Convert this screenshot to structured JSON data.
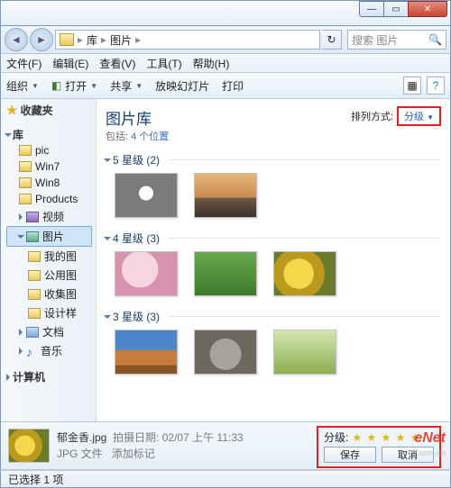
{
  "window": {
    "breadcrumb": {
      "root": "库",
      "lib": "图片"
    },
    "search_placeholder": "搜索 图片"
  },
  "menubar": {
    "file": "文件(F)",
    "edit": "编辑(E)",
    "view": "查看(V)",
    "tools": "工具(T)",
    "help": "帮助(H)"
  },
  "toolbar": {
    "organize": "组织",
    "open": "打开",
    "share": "共享",
    "slideshow": "放映幻灯片",
    "print": "打印"
  },
  "sidebar": {
    "favorites": "收藏夹",
    "libraries": "库",
    "items": [
      "pic",
      "Win7",
      "Win8",
      "Products",
      "视频",
      "图片",
      "我的图",
      "公用图",
      "收集图",
      "设计样",
      "文档",
      "音乐"
    ],
    "computer": "计算机"
  },
  "content": {
    "title": "图片库",
    "subtitle_prefix": "包括: ",
    "subtitle_link": "4 个位置",
    "sort_label": "排列方式:",
    "sort_value": "分级",
    "groups": [
      {
        "label": "5 星级 (2)"
      },
      {
        "label": "4 星级 (3)"
      },
      {
        "label": "3 星级 (3)"
      }
    ]
  },
  "details": {
    "filename": "郁金香.jpg",
    "date_label": "拍摄日期:",
    "date_value": "02/07 上午 11:33",
    "type": "JPG 文件",
    "tags_prompt": "添加标记",
    "rating_label": "分级:",
    "save": "保存",
    "cancel": "取消"
  },
  "status": {
    "text": "已选择 1 项"
  },
  "watermark": {
    "brand": "eNet",
    "url": ".com.cn"
  }
}
